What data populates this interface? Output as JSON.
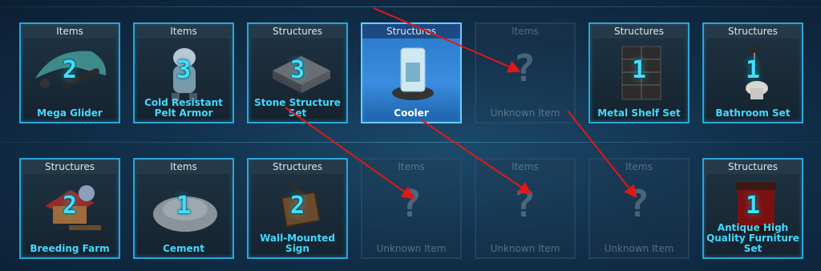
{
  "row1": [
    {
      "category": "Items",
      "count": "2",
      "name": "Mega Glider",
      "state": "normal",
      "icon": "glider-icon"
    },
    {
      "category": "Items",
      "count": "3",
      "name": "Cold Resistant Pelt Armor",
      "state": "normal",
      "icon": "pelt-armor-icon"
    },
    {
      "category": "Structures",
      "count": "3",
      "name": "Stone Structure Set",
      "state": "normal",
      "icon": "stone-structure-icon"
    },
    {
      "category": "Structures",
      "count": "",
      "name": "Cooler",
      "state": "selected",
      "icon": "cooler-icon"
    },
    {
      "category": "Items",
      "count": "",
      "name": "Unknown Item",
      "state": "unknown",
      "icon": "question-mark-icon"
    },
    {
      "category": "Structures",
      "count": "1",
      "name": "Metal Shelf Set",
      "state": "normal",
      "icon": "metal-shelf-icon"
    },
    {
      "category": "Structures",
      "count": "1",
      "name": "Bathroom Set",
      "state": "normal",
      "icon": "toilet-icon"
    }
  ],
  "row2": [
    {
      "category": "Structures",
      "count": "2",
      "name": "Breeding Farm",
      "state": "normal",
      "icon": "breeding-farm-icon"
    },
    {
      "category": "Items",
      "count": "1",
      "name": "Cement",
      "state": "normal",
      "icon": "cement-pile-icon"
    },
    {
      "category": "Structures",
      "count": "2",
      "name": "Wall-Mounted Sign",
      "state": "normal",
      "icon": "wall-sign-icon"
    },
    {
      "category": "Items",
      "count": "",
      "name": "Unknown Item",
      "state": "unknown",
      "icon": "question-mark-icon"
    },
    {
      "category": "Items",
      "count": "",
      "name": "Unknown Item",
      "state": "unknown",
      "icon": "question-mark-icon"
    },
    {
      "category": "Items",
      "count": "",
      "name": "Unknown Item",
      "state": "unknown",
      "icon": "question-mark-icon"
    },
    {
      "category": "Structures",
      "count": "1",
      "name": "Antique High Quality Furniture Set",
      "state": "normal",
      "icon": "antique-furniture-icon"
    }
  ],
  "unknown_glyph": "?",
  "colors": {
    "accent": "#2aa6d8",
    "count_text": "#3fe0ff",
    "selected_bg": "#3a8de0",
    "annotation_arrow": "#e01818"
  }
}
